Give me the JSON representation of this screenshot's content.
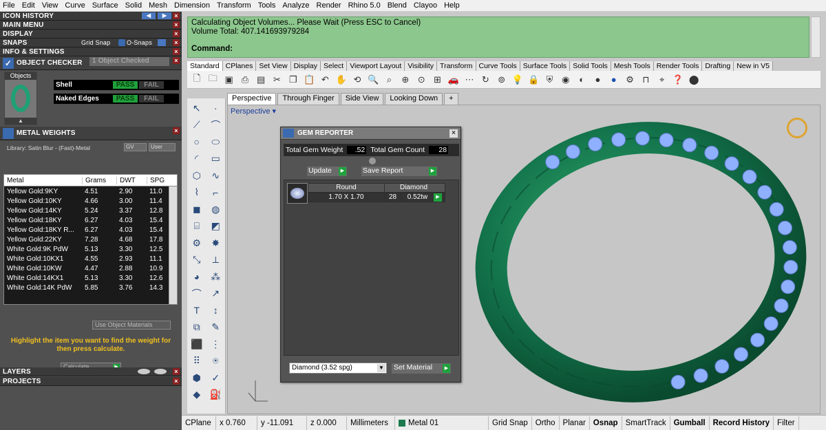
{
  "menu": [
    "File",
    "Edit",
    "View",
    "Curve",
    "Surface",
    "Solid",
    "Mesh",
    "Dimension",
    "Transform",
    "Tools",
    "Analyze",
    "Render",
    "Rhino 5.0",
    "Blend",
    "Clayoo",
    "Help"
  ],
  "left": {
    "icon_history": "ICON HISTORY",
    "main_menu": "MAIN MENU",
    "display": "DISPLAY",
    "snaps": "SNAPS",
    "grid_snap": "Grid Snap",
    "osnaps": "O-Snaps",
    "info": "INFO & SETTINGS",
    "object_checker": "OBJECT CHECKER",
    "object_checked": "1  Object Checked",
    "objects_label": "Objects",
    "checks": [
      {
        "name": "Shell",
        "pass": "PASS",
        "fail": "FAIL"
      },
      {
        "name": "Naked Edges",
        "pass": "PASS",
        "fail": "FAIL"
      }
    ],
    "metal_weights": "METAL WEIGHTS",
    "library": "Library: Satin Blur - (Fast)-Metal",
    "gv": "GV",
    "user": "User",
    "columns": [
      "Metal",
      "Grams",
      "DWT",
      "SPG"
    ],
    "rows": [
      [
        "Yellow Gold:9KY",
        "4.51",
        "2.90",
        "11.0"
      ],
      [
        "Yellow Gold:10KY",
        "4.66",
        "3.00",
        "11.4"
      ],
      [
        "Yellow Gold:14KY",
        "5.24",
        "3.37",
        "12.8"
      ],
      [
        "Yellow Gold:18KY",
        "6.27",
        "4.03",
        "15.4"
      ],
      [
        "Yellow Gold:18KY R...",
        "6.27",
        "4.03",
        "15.4"
      ],
      [
        "Yellow Gold:22KY",
        "7.28",
        "4.68",
        "17.8"
      ],
      [
        "White Gold:9K PdW",
        "5.13",
        "3.30",
        "12.5"
      ],
      [
        "White Gold:10KX1",
        "4.55",
        "2.93",
        "11.1"
      ],
      [
        "White Gold:10KW",
        "4.47",
        "2.88",
        "10.9"
      ],
      [
        "White Gold:14KX1",
        "5.13",
        "3.30",
        "12.6"
      ],
      [
        "White Gold:14K PdW",
        "5.85",
        "3.76",
        "14.3"
      ]
    ],
    "use_object_materials": "Use Object Materials",
    "hint": "Highlight the item you want to find the weight for then press calculate.",
    "calculate": "Calculate",
    "layers": "LAYERS",
    "projects": "PROJECTS"
  },
  "command": {
    "line1": "Calculating Object Volumes... Please Wait (Press ESC to Cancel)",
    "line2": "Volume Total: 407.141693979284",
    "prompt": "Command:"
  },
  "toolbar_tabs": [
    "Standard",
    "CPlanes",
    "Set View",
    "Display",
    "Select",
    "Viewport Layout",
    "Visibility",
    "Transform",
    "Curve Tools",
    "Surface Tools",
    "Solid Tools",
    "Mesh Tools",
    "Render Tools",
    "Drafting",
    "New in V5"
  ],
  "view_tabs": [
    "Perspective",
    "Through Finger",
    "Side View",
    "Looking Down"
  ],
  "viewport_label": "Perspective",
  "gem_reporter": {
    "title": "GEM REPORTER",
    "total_weight_label": "Total Gem Weight",
    "total_weight": ".52",
    "total_count_label": "Total Gem Count",
    "total_count": "28",
    "update": "Update",
    "save_report": "Save Report",
    "shape": "Round",
    "material": "Diamond",
    "size": "1.70 X 1.70",
    "count": "28",
    "tw": "0.52tw",
    "select_value": "Diamond      (3.52 spg)",
    "set_material": "Set Material"
  },
  "status": {
    "cplane": "CPlane",
    "x": "x 0.760",
    "y": "y -11.091",
    "z": "z 0.000",
    "units": "Millimeters",
    "layer": "Metal 01",
    "items": [
      "Grid Snap",
      "Ortho",
      "Planar",
      "Osnap",
      "SmartTrack",
      "Gumball",
      "Record History",
      "Filter"
    ]
  },
  "colors": {
    "accent_green": "#1fa23c",
    "cmd_bg": "#8cc78d",
    "ring": "#14794a",
    "gem": "#8fb0ff"
  }
}
